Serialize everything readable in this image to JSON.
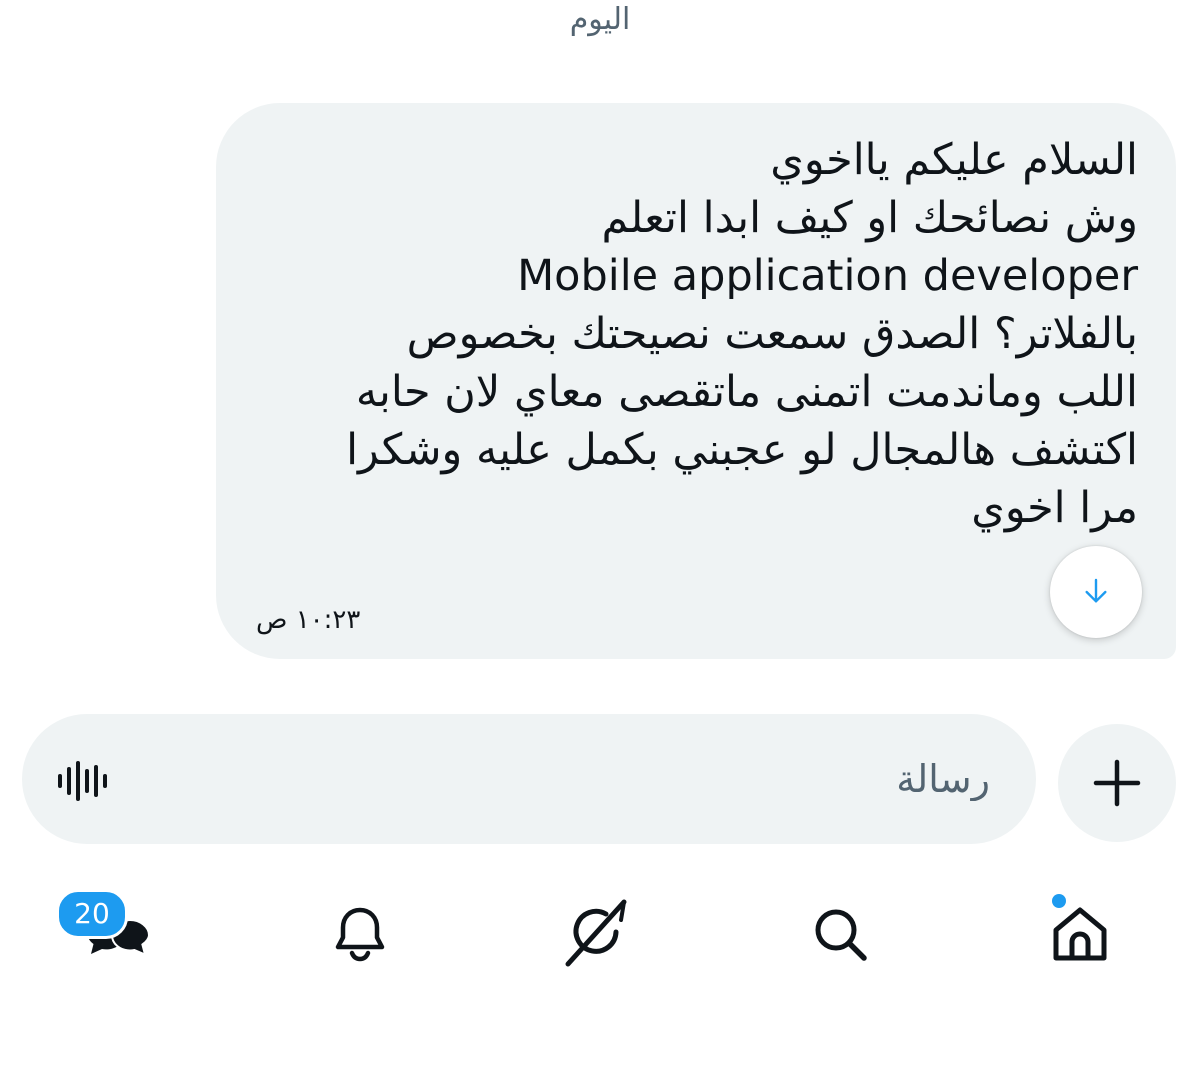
{
  "conversation": {
    "date_separator": "اليوم",
    "message": {
      "text_lines": [
        "السلام عليكم يااخوي",
        "وش نصائحك او كيف ابدا اتعلم",
        "Mobile application developer",
        "بالفلاتر؟ الصدق سمعت نصيحتك بخصوص",
        "اللب وماندمت اتمنى ماتقصى معاي لان حابه",
        "اكتشف هالمجال لو عجبني بكمل عليه  وشكرا",
        "مرا اخوي"
      ],
      "time": "١٠:٢٣ ص"
    },
    "scroll_down_icon": "arrow-down-icon"
  },
  "composer": {
    "placeholder": "رسالة",
    "value": "",
    "voice_icon": "waveform-icon",
    "add_icon": "plus-icon"
  },
  "bottom_nav": {
    "items": [
      {
        "name": "messages",
        "icon": "messages-icon",
        "badge": "20"
      },
      {
        "name": "notifications",
        "icon": "bell-icon"
      },
      {
        "name": "grok",
        "icon": "grok-icon"
      },
      {
        "name": "search",
        "icon": "search-icon"
      },
      {
        "name": "home",
        "icon": "home-icon",
        "has_dot": true
      }
    ]
  },
  "colors": {
    "accent": "#1d9bf0",
    "bubble": "#eff3f4",
    "text": "#0f1419",
    "muted": "#536471"
  }
}
